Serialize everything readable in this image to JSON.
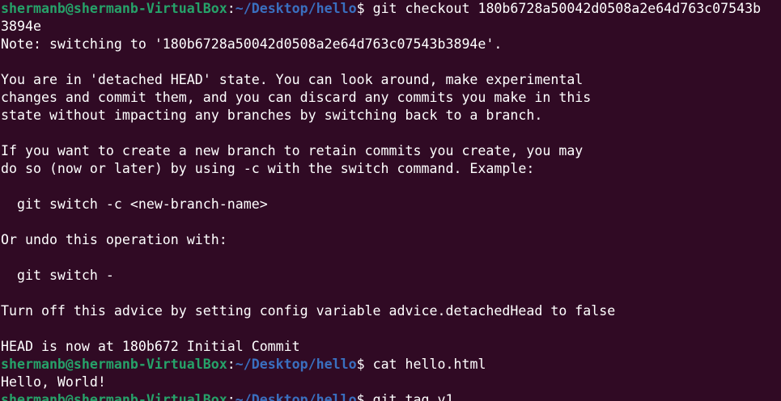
{
  "terminal": {
    "prompt_user": "shermanb@shermanb-VirtualBox",
    "prompt_colon": ":",
    "prompt_path": "~/Desktop/hello",
    "prompt_dollar": "$ ",
    "cmd1": "git checkout 180b6728a50042d0508a2e64d763c07543b",
    "cmd1_wrap": "3894e",
    "lines": [
      "Note: switching to '180b6728a50042d0508a2e64d763c07543b3894e'.",
      "",
      "You are in 'detached HEAD' state. You can look around, make experimental",
      "changes and commit them, and you can discard any commits you make in this",
      "state without impacting any branches by switching back to a branch.",
      "",
      "If you want to create a new branch to retain commits you create, you may",
      "do so (now or later) by using -c with the switch command. Example:",
      "",
      "  git switch -c <new-branch-name>",
      "",
      "Or undo this operation with:",
      "",
      "  git switch -",
      "",
      "Turn off this advice by setting config variable advice.detachedHead to false",
      "",
      "HEAD is now at 180b672 Initial Commit"
    ],
    "cmd2": "cat hello.html",
    "output2": "Hello, World!",
    "cmd3": "git tag v1"
  }
}
